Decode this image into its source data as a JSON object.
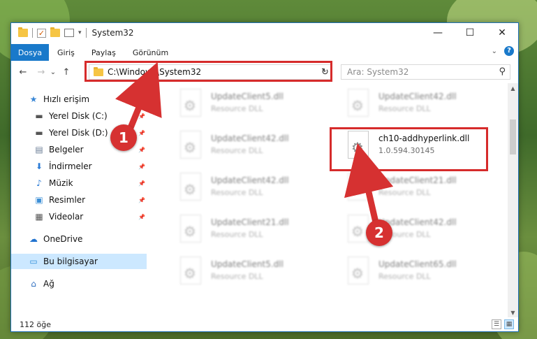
{
  "titlebar": {
    "title": "System32",
    "check_glyph": "✓",
    "dropdown_glyph": "▾",
    "minimize_glyph": "—",
    "maximize_glyph": "☐",
    "close_glyph": "✕"
  },
  "ribbon": {
    "tabs": [
      "Dosya",
      "Giriş",
      "Paylaş",
      "Görünüm"
    ],
    "collapse_glyph": "⌄",
    "help_glyph": "?"
  },
  "nav": {
    "back_glyph": "←",
    "forward_glyph": "→",
    "recent_glyph": "⌄",
    "up_glyph": "↑",
    "address": "C:\\Windows\\System32",
    "address_dropdown_glyph": "⌄",
    "refresh_glyph": "↻",
    "search_placeholder": "Ara: System32",
    "search_glyph": "⚲"
  },
  "sidebar": {
    "pin_glyph": "📌",
    "items": [
      {
        "label": "Hızlı erişim",
        "icon": "star-icon",
        "glyph": "★",
        "color": "#3a87d6",
        "pinned": false
      },
      {
        "label": "Yerel Disk (C:)",
        "icon": "drive-icon",
        "glyph": "▬",
        "color": "#555555",
        "pinned": true
      },
      {
        "label": "Yerel Disk (D:)",
        "icon": "drive-icon",
        "glyph": "▬",
        "color": "#555555",
        "pinned": true
      },
      {
        "label": "Belgeler",
        "icon": "documents-icon",
        "glyph": "▤",
        "color": "#6a7d96",
        "pinned": true
      },
      {
        "label": "İndirmeler",
        "icon": "download-icon",
        "glyph": "⬇",
        "color": "#2b7bd6",
        "pinned": true
      },
      {
        "label": "Müzik",
        "icon": "music-icon",
        "glyph": "♪",
        "color": "#2b7bd6",
        "pinned": true
      },
      {
        "label": "Resimler",
        "icon": "pictures-icon",
        "glyph": "▣",
        "color": "#3c8fd6",
        "pinned": true
      },
      {
        "label": "Videolar",
        "icon": "videos-icon",
        "glyph": "▦",
        "color": "#555555",
        "pinned": true
      },
      {
        "label": "OneDrive",
        "icon": "cloud-icon",
        "glyph": "☁",
        "color": "#2173cf",
        "pinned": false
      },
      {
        "label": "Bu bilgisayar",
        "icon": "computer-icon",
        "glyph": "▭",
        "color": "#2f8ed8",
        "pinned": false
      },
      {
        "label": "Ağ",
        "icon": "network-icon",
        "glyph": "⌂",
        "color": "#2f6fc0",
        "pinned": false
      }
    ]
  },
  "files": {
    "gear_glyph": "⚙",
    "items": [
      {
        "name": "UpdateClient5.dll",
        "sub": "Resource DLL",
        "highlight": false
      },
      {
        "name": "UpdateClient42.dll",
        "sub": "Resource DLL",
        "highlight": false
      },
      {
        "name": "UpdateClient42.dll",
        "sub": "Resource DLL",
        "highlight": false
      },
      {
        "name": "ch10-addhyperlink.dll",
        "sub": "1.0.594.30145",
        "highlight": true
      },
      {
        "name": "UpdateClient42.dll",
        "sub": "Resource DLL",
        "highlight": false
      },
      {
        "name": "UpdateClient21.dll",
        "sub": "Resource DLL",
        "highlight": false
      },
      {
        "name": "UpdateClient21.dll",
        "sub": "Resource DLL",
        "highlight": false
      },
      {
        "name": "UpdateClient42.dll",
        "sub": "Resource DLL",
        "highlight": false
      },
      {
        "name": "UpdateClient5.dll",
        "sub": "Resource DLL",
        "highlight": false
      },
      {
        "name": "UpdateClient65.dll",
        "sub": "Resource DLL",
        "highlight": false
      }
    ]
  },
  "scrollbar": {
    "up_glyph": "▲",
    "down_glyph": "▼"
  },
  "status": {
    "count": "112 öğe",
    "details_view_glyph": "☰",
    "tiles_view_glyph": "▦"
  },
  "annotations": {
    "step1": "1",
    "step2": "2",
    "color": "#d63131"
  }
}
